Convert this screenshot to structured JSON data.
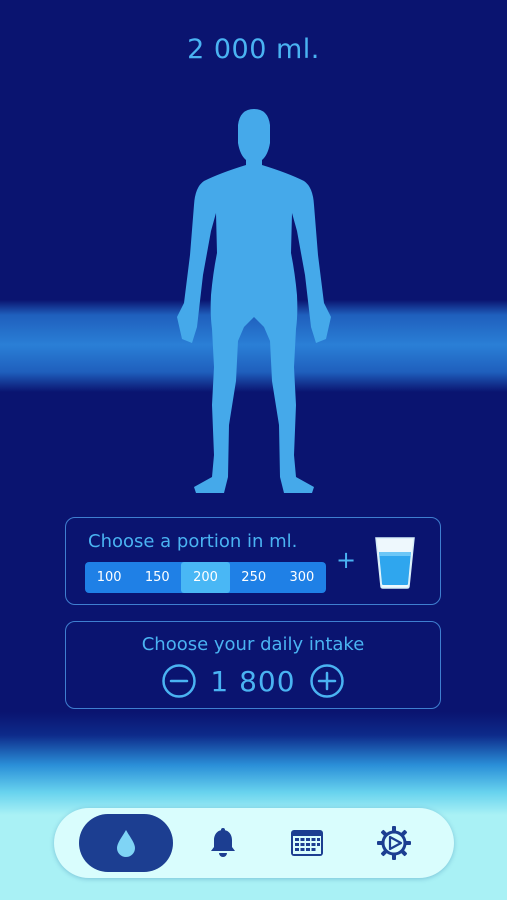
{
  "total": {
    "value": "2 000 ml."
  },
  "portion": {
    "title": "Choose a portion in ml.",
    "options": [
      "100",
      "150",
      "200",
      "250",
      "300"
    ],
    "selected": "200",
    "plus": "+"
  },
  "intake": {
    "title": "Choose your daily intake",
    "value": "1 800"
  },
  "nav": {
    "items": [
      {
        "icon": "water-drop-icon",
        "active": true
      },
      {
        "icon": "bell-icon",
        "active": false
      },
      {
        "icon": "calendar-icon",
        "active": false
      },
      {
        "icon": "settings-gear-icon",
        "active": false
      }
    ]
  },
  "colors": {
    "background_dark": "#0a1470",
    "accent": "#4ab3f2",
    "portion_bar": "#1f80e6",
    "portion_selected": "#49b7f5",
    "nav_background": "#d9fdfd",
    "nav_active": "#1c3e91"
  }
}
